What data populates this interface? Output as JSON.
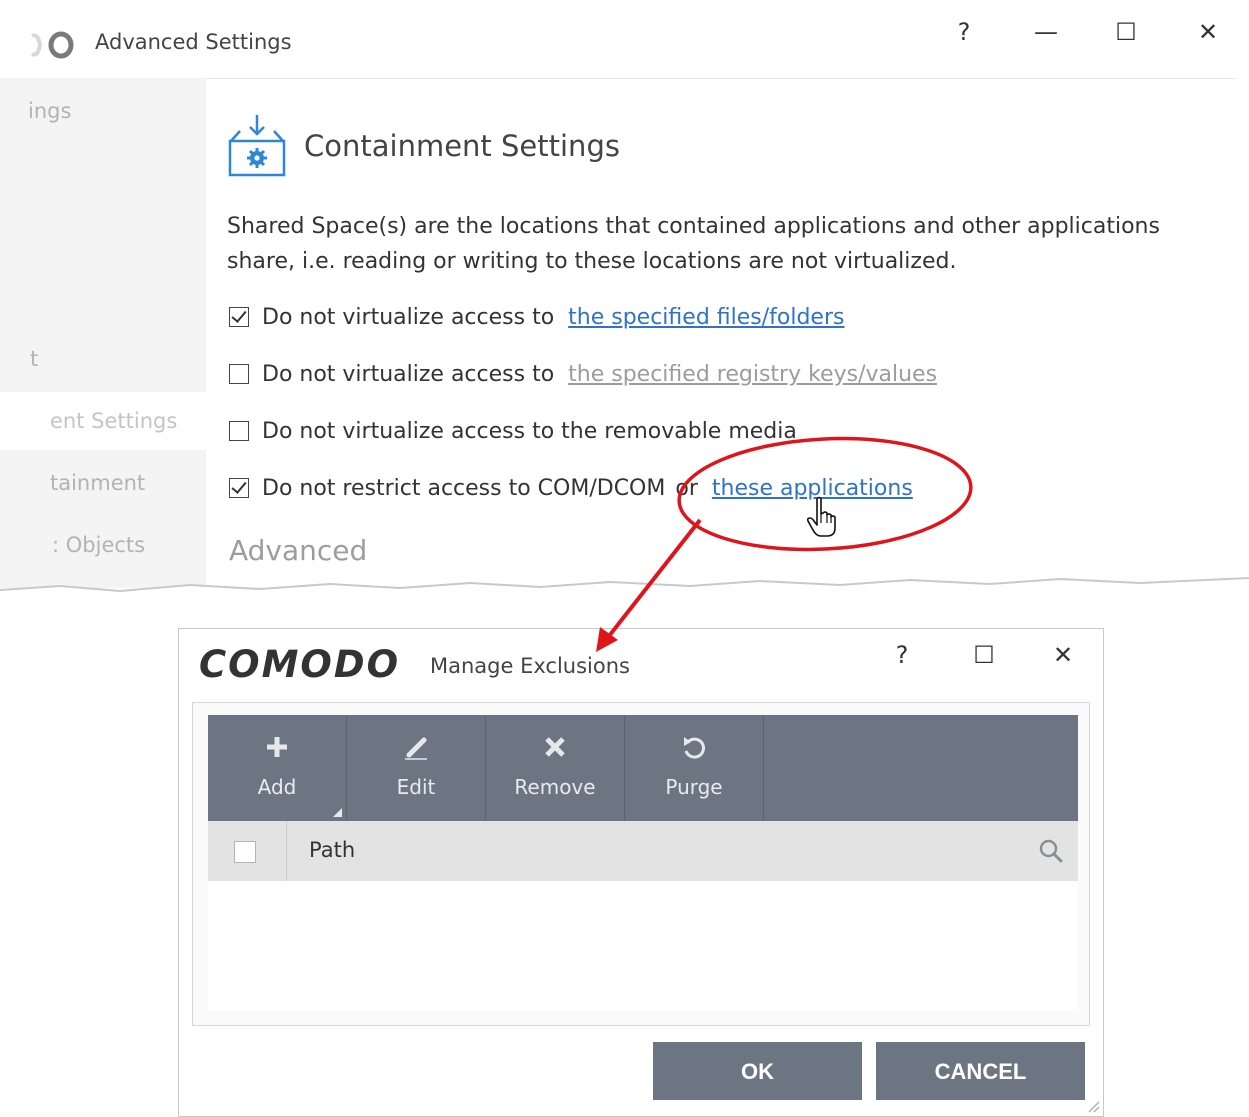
{
  "advanced_window": {
    "title": "Advanced Settings",
    "controls": {
      "help": "?",
      "minimize": "—",
      "maximize": "☐",
      "close": "✕"
    },
    "sidebar": [
      {
        "label": "ings"
      },
      {
        "label": "t"
      },
      {
        "label": "ent Settings",
        "active": true
      },
      {
        "label": "tainment"
      },
      {
        "label": ": Objects"
      }
    ],
    "section_title": "Containment Settings",
    "description": "Shared Space(s) are the locations that contained applications and other applications share, i.e. reading or writing to these locations are not virtualized.",
    "options": [
      {
        "checked": true,
        "text": "Do not virtualize access to",
        "link": "the specified files/folders",
        "link_enabled": true
      },
      {
        "checked": false,
        "text": "Do not virtualize access to",
        "link": "the specified registry keys/values",
        "link_enabled": false
      },
      {
        "checked": false,
        "text": "Do not virtualize access to the removable media"
      },
      {
        "checked": true,
        "text": "Do not restrict access to COM/DCOM",
        "connector": "or",
        "link": "these applications",
        "link_enabled": true
      }
    ],
    "advanced_heading": "Advanced"
  },
  "dialog": {
    "brand": "COMODO",
    "title": "Manage Exclusions",
    "controls": {
      "help": "?",
      "maximize": "☐",
      "close": "✕"
    },
    "toolbar": [
      {
        "label": "Add",
        "icon": "plus-icon",
        "has_dropdown": true
      },
      {
        "label": "Edit",
        "icon": "pencil-icon"
      },
      {
        "label": "Remove",
        "icon": "x-icon"
      },
      {
        "label": "Purge",
        "icon": "refresh-icon"
      }
    ],
    "table": {
      "column_path": "Path",
      "rows": []
    },
    "ok_label": "OK",
    "cancel_label": "CANCEL"
  },
  "colors": {
    "link": "#2f73c9",
    "toolbar": "#6c7683",
    "annotation": "#e0141b"
  }
}
